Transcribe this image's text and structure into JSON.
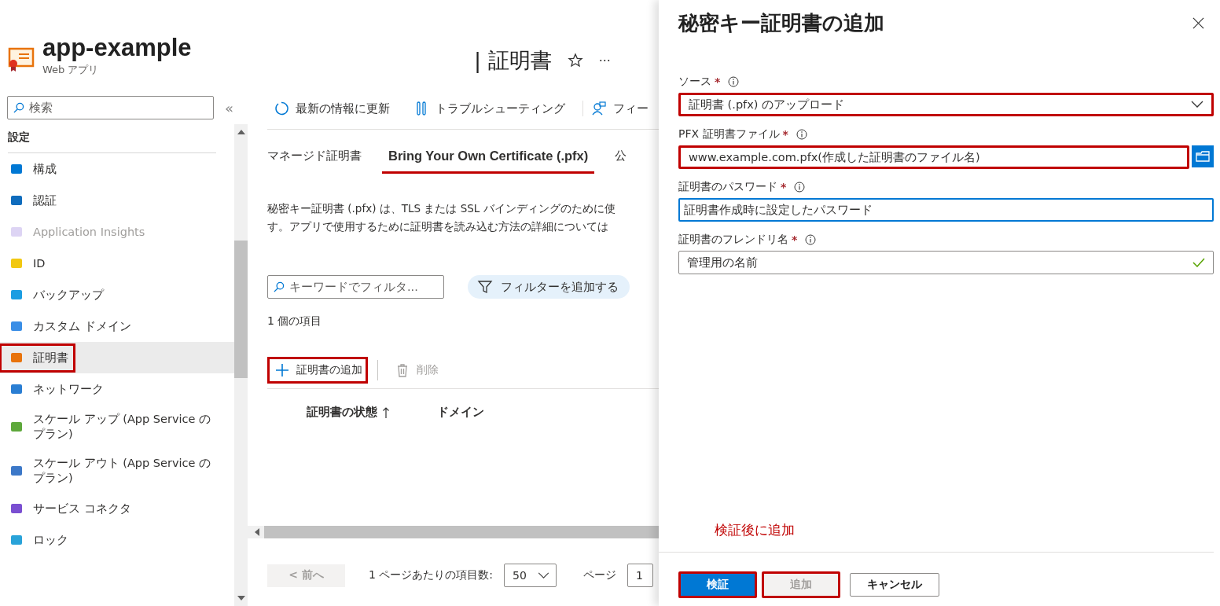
{
  "resource": {
    "title": "app-example",
    "subtitle": "Web アプリ"
  },
  "sidebar": {
    "search_placeholder": "検索",
    "collapse": "«",
    "section": "設定",
    "items": [
      {
        "label": "構成",
        "selected": false,
        "disabled": false,
        "highlighted": false
      },
      {
        "label": "認証",
        "selected": false,
        "disabled": false,
        "highlighted": false
      },
      {
        "label": "Application Insights",
        "selected": false,
        "disabled": true,
        "highlighted": false
      },
      {
        "label": "ID",
        "selected": false,
        "disabled": false,
        "highlighted": false
      },
      {
        "label": "バックアップ",
        "selected": false,
        "disabled": false,
        "highlighted": false
      },
      {
        "label": "カスタム ドメイン",
        "selected": false,
        "disabled": false,
        "highlighted": false
      },
      {
        "label": "証明書",
        "selected": true,
        "disabled": false,
        "highlighted": true
      },
      {
        "label": "ネットワーク",
        "selected": false,
        "disabled": false,
        "highlighted": false
      },
      {
        "label": "スケール アップ (App Service のプラン)",
        "selected": false,
        "disabled": false,
        "highlighted": false
      },
      {
        "label": "スケール アウト (App Service のプラン)",
        "selected": false,
        "disabled": false,
        "highlighted": false
      },
      {
        "label": "サービス コネクタ",
        "selected": false,
        "disabled": false,
        "highlighted": false
      },
      {
        "label": "ロック",
        "selected": false,
        "disabled": false,
        "highlighted": false
      }
    ]
  },
  "page": {
    "title": "| 証明書",
    "more": "···",
    "toolbar": [
      "最新の情報に更新",
      "トラブルシューティング",
      "フィー"
    ],
    "tabs": [
      {
        "label": "マネージド証明書",
        "selected": false
      },
      {
        "label": "Bring Your Own Certificate (.pfx)",
        "selected": true
      },
      {
        "label": "公",
        "selected": false
      }
    ],
    "description": [
      "秘密キー証明書 (.pfx) は、TLS または SSL バインディングのために使",
      "す。アプリで使用するために証明書を読み込む方法の詳細については"
    ],
    "filter_placeholder": "キーワードでフィルタ...",
    "add_filter": "フィルターを追加する",
    "count": "1 個の項目",
    "commands": [
      {
        "label": "証明書の追加",
        "disabled": false,
        "highlighted": true
      },
      {
        "label": "削除",
        "disabled": true,
        "highlighted": false
      }
    ],
    "columns": [
      {
        "label": "証明書の状態",
        "sorted": true
      },
      {
        "label": "ドメイン",
        "sorted": false
      }
    ],
    "pager": {
      "prev": "< 前へ",
      "per_page_label": "1 ページあたりの項目数:",
      "per_page": "50",
      "page_label": "ページ",
      "page": "1"
    }
  },
  "panel": {
    "title": "秘密キー証明書の追加",
    "fields": [
      {
        "kind": "select",
        "label": "ソース",
        "required": "*",
        "value": "証明書 (.pfx) のアップロード",
        "highlighted": true,
        "focused": false,
        "valid": false
      },
      {
        "kind": "file",
        "label": "PFX 証明書ファイル",
        "required": "*",
        "value": "www.example.com.pfx(作成した証明書のファイル名)",
        "highlighted": true,
        "focused": false,
        "valid": false
      },
      {
        "kind": "text",
        "label": "証明書のパスワード",
        "required": "*",
        "value": "証明書作成時に設定したパスワード",
        "highlighted": false,
        "focused": true,
        "valid": false
      },
      {
        "kind": "text",
        "label": "証明書のフレンドリ名",
        "required": "*",
        "value": "管理用の名前",
        "highlighted": false,
        "focused": false,
        "valid": true
      }
    ],
    "note": "検証後に追加",
    "buttons": [
      {
        "label": "検証",
        "kind": "primary",
        "disabled": false,
        "highlighted": true
      },
      {
        "label": "追加",
        "kind": "default",
        "disabled": true,
        "highlighted": true
      },
      {
        "label": "キャンセル",
        "kind": "default",
        "disabled": false,
        "highlighted": false
      }
    ]
  }
}
